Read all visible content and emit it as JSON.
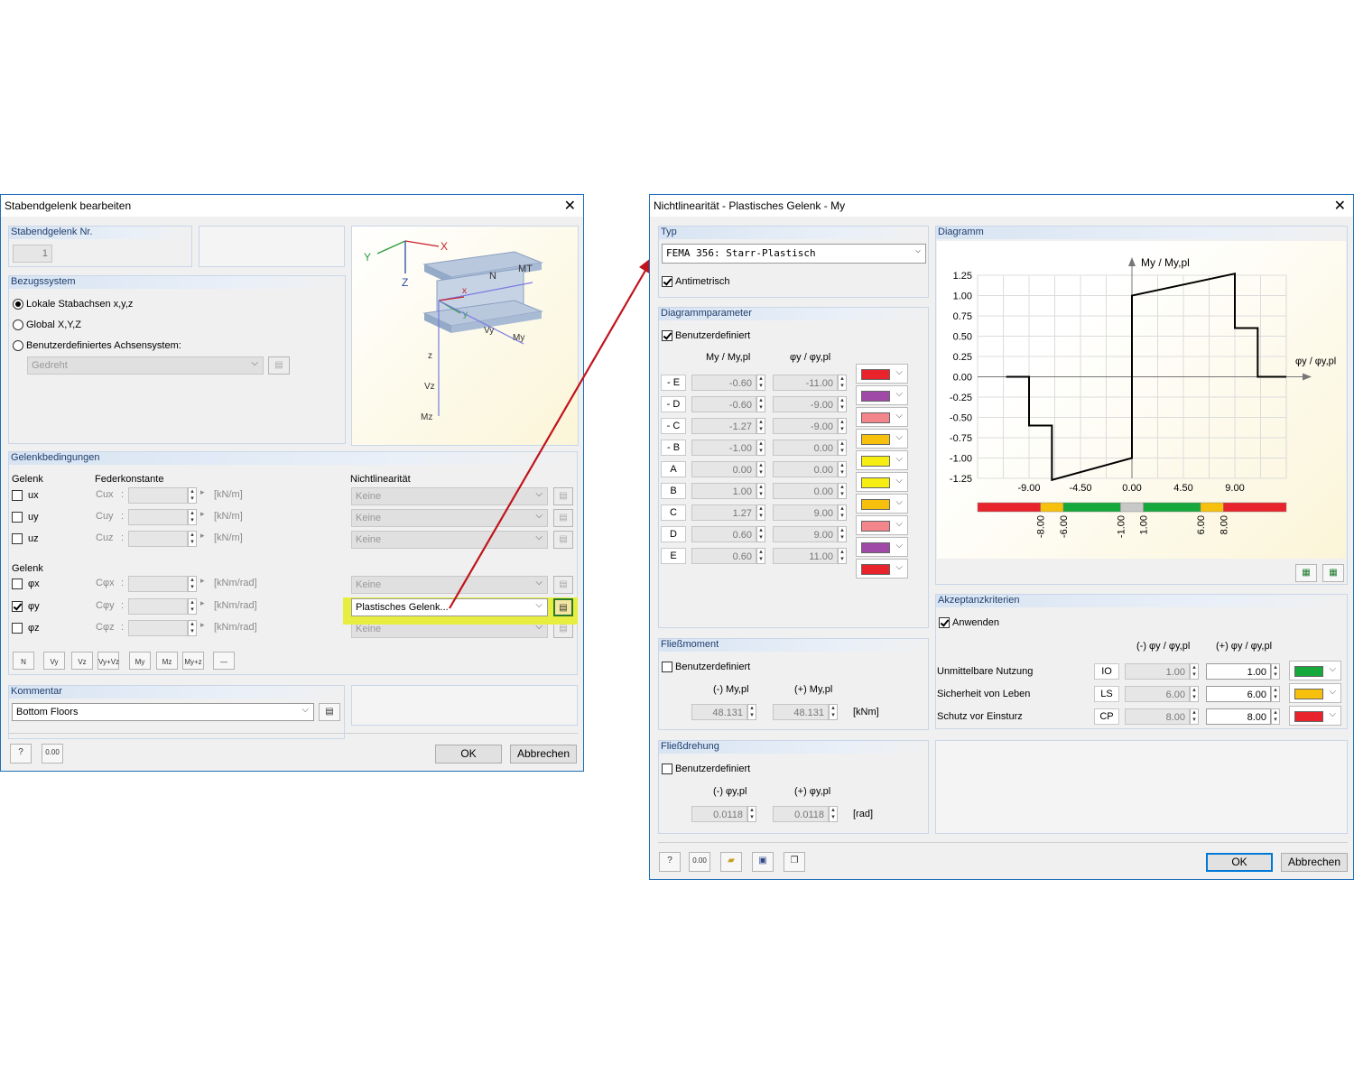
{
  "left_dialog": {
    "title": "Stabendgelenk bearbeiten",
    "hinge_no": {
      "header": "Stabendgelenk Nr.",
      "value": "1"
    },
    "ref_system": {
      "header": "Bezugssystem",
      "options": [
        "Lokale Stabachsen x,y,z",
        "Global X,Y,Z",
        "Benutzerdefiniertes Achsensystem:"
      ],
      "selected_index": 0,
      "dropdown_value": "Gedreht"
    },
    "graphic_labels": {
      "Y": "Y",
      "X": "X",
      "Z": "Z",
      "N": "N",
      "MT": "MT",
      "x": "x",
      "y": "y",
      "z": "z",
      "Vy": "Vy",
      "My": "My",
      "Vz": "Vz",
      "Mz": "Mz"
    },
    "conditions": {
      "header": "Gelenkbedingungen",
      "col_gelenk": "Gelenk",
      "col_feder": "Federkonstante",
      "col_nonlin": "Nichtlinearität",
      "col_gelenk2": "Gelenk",
      "rows": [
        {
          "label": "ux",
          "checked": false,
          "c": "Cux",
          "unit": "[kN/m]",
          "nonlin": "Keine",
          "active": false
        },
        {
          "label": "uy",
          "checked": false,
          "c": "Cuy",
          "unit": "[kN/m]",
          "nonlin": "Keine",
          "active": false
        },
        {
          "label": "uz",
          "checked": false,
          "c": "Cuz",
          "unit": "[kN/m]",
          "nonlin": "Keine",
          "active": false
        },
        {
          "label": "φx",
          "checked": false,
          "c": "Cφx",
          "unit": "[kNm/rad]",
          "nonlin": "Keine",
          "active": false
        },
        {
          "label": "φy",
          "checked": true,
          "c": "Cφy",
          "unit": "[kNm/rad]",
          "nonlin": "Plastisches Gelenk...",
          "active": true
        },
        {
          "label": "φz",
          "checked": false,
          "c": "Cφz",
          "unit": "[kNm/rad]",
          "nonlin": "Keine",
          "active": false
        }
      ],
      "toolbar_icons": [
        "N",
        "Vy",
        "Vz",
        "Vy+Vz",
        "My",
        "Mz",
        "My+z",
        "—"
      ]
    },
    "comment": {
      "header": "Kommentar",
      "value": "Bottom Floors"
    },
    "ok": "OK",
    "cancel": "Abbrechen",
    "calc_icon_label": "0.00"
  },
  "right_dialog": {
    "title": "Nichtlinearität - Plastisches Gelenk - My",
    "typ": {
      "header": "Typ",
      "value": "FEMA 356: Starr-Plastisch",
      "antimetric_label": "Antimetrisch",
      "antimetric": true
    },
    "params": {
      "header": "Diagrammparameter",
      "custom_label": "Benutzerdefiniert",
      "custom": true,
      "col1": "My / My,pl",
      "col2": "φy / φy,pl",
      "rows": [
        {
          "label": "- E",
          "m": "-0.60",
          "phi": "-11.00",
          "color": "#e8232b"
        },
        {
          "label": "- D",
          "m": "-0.60",
          "phi": "-9.00",
          "color": "#a04aa8"
        },
        {
          "label": "- C",
          "m": "-1.27",
          "phi": "-9.00",
          "color": "#f2868c"
        },
        {
          "label": "- B",
          "m": "-1.00",
          "phi": "0.00",
          "color": "#f7c00d"
        },
        {
          "label": "A",
          "m": "0.00",
          "phi": "0.00",
          "color": "#f6ee13"
        },
        {
          "label": "B",
          "m": "1.00",
          "phi": "0.00",
          "color": "#f6ee13"
        },
        {
          "label": "C",
          "m": "1.27",
          "phi": "9.00",
          "color": "#f7c00d"
        },
        {
          "label": "D",
          "m": "0.60",
          "phi": "9.00",
          "color": "#f2868c"
        },
        {
          "label": "E",
          "m": "0.60",
          "phi": "11.00",
          "color": "#a04aa8"
        },
        {
          "label": "",
          "m": "",
          "phi": "",
          "color": "#e8232b"
        }
      ]
    },
    "yield_moment": {
      "header": "Fließmoment",
      "custom_label": "Benutzerdefiniert",
      "neg_label": "(-) My,pl",
      "pos_label": "(+) My,pl",
      "neg": "48.131",
      "pos": "48.131",
      "unit": "[kNm]"
    },
    "yield_rotation": {
      "header": "Fließdrehung",
      "custom_label": "Benutzerdefiniert",
      "neg_label": "(-) φy,pl",
      "pos_label": "(+) φy,pl",
      "neg": "0.0118",
      "pos": "0.0118",
      "unit": "[rad]"
    },
    "diagram": {
      "header": "Diagramm"
    },
    "acceptance": {
      "header": "Akzeptanzkriterien",
      "apply_label": "Anwenden",
      "apply": true,
      "col_neg": "(-) φy / φy,pl",
      "col_pos": "(+) φy / φy,pl",
      "rows": [
        {
          "label": "Unmittelbare Nutzung",
          "code": "IO",
          "neg": "1.00",
          "pos": "1.00",
          "color": "#16a83a"
        },
        {
          "label": "Sicherheit von Leben",
          "code": "LS",
          "neg": "6.00",
          "pos": "6.00",
          "color": "#f7c00d"
        },
        {
          "label": "Schutz vor Einsturz",
          "code": "CP",
          "neg": "8.00",
          "pos": "8.00",
          "color": "#e8232b"
        }
      ]
    },
    "ok": "OK",
    "cancel": "Abbrechen",
    "calc_icon_label": "0.00"
  },
  "chart_data": {
    "type": "line",
    "ylabel": "My / My,pl",
    "xlabel": "φy / φy,pl",
    "series": [
      {
        "x": [
          -11.0,
          -9.0,
          -9.0,
          -9.0,
          0.0,
          0.0,
          0.0,
          9.0,
          9.0,
          9.0,
          11.0
        ],
        "y": [
          0.0,
          0.0,
          -0.6,
          -1.27,
          -1.0,
          0.0,
          1.0,
          1.27,
          0.6,
          0.6,
          0.0
        ]
      }
    ],
    "points": [
      [
        -11.0,
        0.0
      ],
      [
        -9.0,
        0.0
      ],
      [
        -9.0,
        -0.6
      ],
      [
        -7.0,
        -0.6
      ],
      [
        -7.0,
        -1.27
      ],
      [
        0.0,
        -1.0
      ],
      [
        0.0,
        1.0
      ],
      [
        9.0,
        1.27
      ],
      [
        9.0,
        0.6
      ],
      [
        11.0,
        0.6
      ],
      [
        11.0,
        0.0
      ],
      [
        13.5,
        0.0
      ]
    ],
    "x_ticks": [
      "-9.00",
      "-4.50",
      "0.00",
      "4.50",
      "9.00"
    ],
    "x_tick_values": [
      -9.0,
      -4.5,
      0.0,
      4.5,
      9.0
    ],
    "y_ticks": [
      "1.25",
      "1.00",
      "0.75",
      "0.50",
      "0.25",
      "0.00",
      "-0.25",
      "-0.50",
      "-0.75",
      "-1.00",
      "-1.25"
    ],
    "y_tick_values": [
      1.25,
      1.0,
      0.75,
      0.5,
      0.25,
      0.0,
      -0.25,
      -0.5,
      -0.75,
      -1.0,
      -1.25
    ],
    "xlim": [
      -13.5,
      13.5
    ],
    "ylim": [
      -1.25,
      1.25
    ],
    "grid": true,
    "acceptance_bar": [
      {
        "from": -13.5,
        "to": -8.0,
        "color": "#e8232b"
      },
      {
        "from": -8.0,
        "to": -6.0,
        "color": "#f7c00d"
      },
      {
        "from": -6.0,
        "to": -1.0,
        "color": "#16a83a"
      },
      {
        "from": -1.0,
        "to": 1.0,
        "color": "#c8c8c8"
      },
      {
        "from": 1.0,
        "to": 6.0,
        "color": "#16a83a"
      },
      {
        "from": 6.0,
        "to": 8.0,
        "color": "#f7c00d"
      },
      {
        "from": 8.0,
        "to": 13.5,
        "color": "#e8232b"
      }
    ],
    "acceptance_labels": [
      "-8.00",
      "-6.00",
      "-1.00",
      "1.00",
      "6.00",
      "8.00"
    ],
    "acceptance_label_values": [
      -8.0,
      -6.0,
      -1.0,
      1.0,
      6.0,
      8.0
    ]
  }
}
